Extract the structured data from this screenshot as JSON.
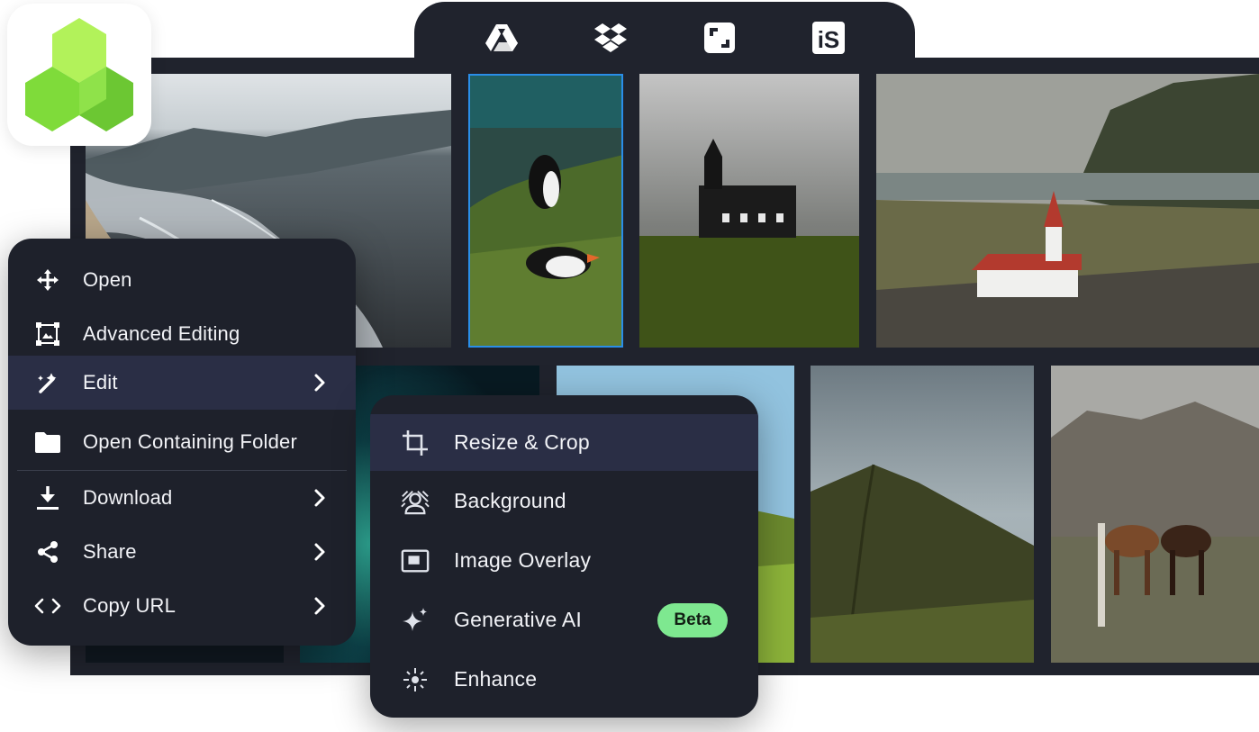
{
  "providers": [
    {
      "name": "google-drive-icon"
    },
    {
      "name": "dropbox-icon"
    },
    {
      "name": "frame-icon"
    },
    {
      "name": "is-icon",
      "text": "iS"
    }
  ],
  "context_menu": {
    "items": [
      {
        "label": "Open",
        "icon": "move-icon"
      },
      {
        "label": "Advanced Editing",
        "icon": "advanced-edit-icon"
      },
      {
        "label": "Edit",
        "icon": "magic-wand-icon",
        "submenu": true,
        "active": true
      },
      {
        "label": "Open Containing Folder",
        "icon": "folder-icon"
      },
      {
        "label": "Download",
        "icon": "download-icon",
        "submenu": true
      },
      {
        "label": "Share",
        "icon": "share-icon",
        "submenu": true
      },
      {
        "label": "Copy URL",
        "icon": "code-icon",
        "submenu": true
      }
    ]
  },
  "edit_submenu": {
    "items": [
      {
        "label": "Resize & Crop",
        "icon": "crop-icon",
        "active": true
      },
      {
        "label": "Background",
        "icon": "background-icon"
      },
      {
        "label": "Image Overlay",
        "icon": "overlay-icon"
      },
      {
        "label": "Generative AI",
        "icon": "sparkles-icon",
        "badge": "Beta"
      },
      {
        "label": "Enhance",
        "icon": "enhance-icon"
      }
    ]
  },
  "colors": {
    "panel": "#20232d",
    "menu": "#1e212b",
    "active_row": "#2a2e45",
    "selection": "#2a8ee8",
    "badge": "#7ee890",
    "logo_green": "#7bd94c"
  }
}
